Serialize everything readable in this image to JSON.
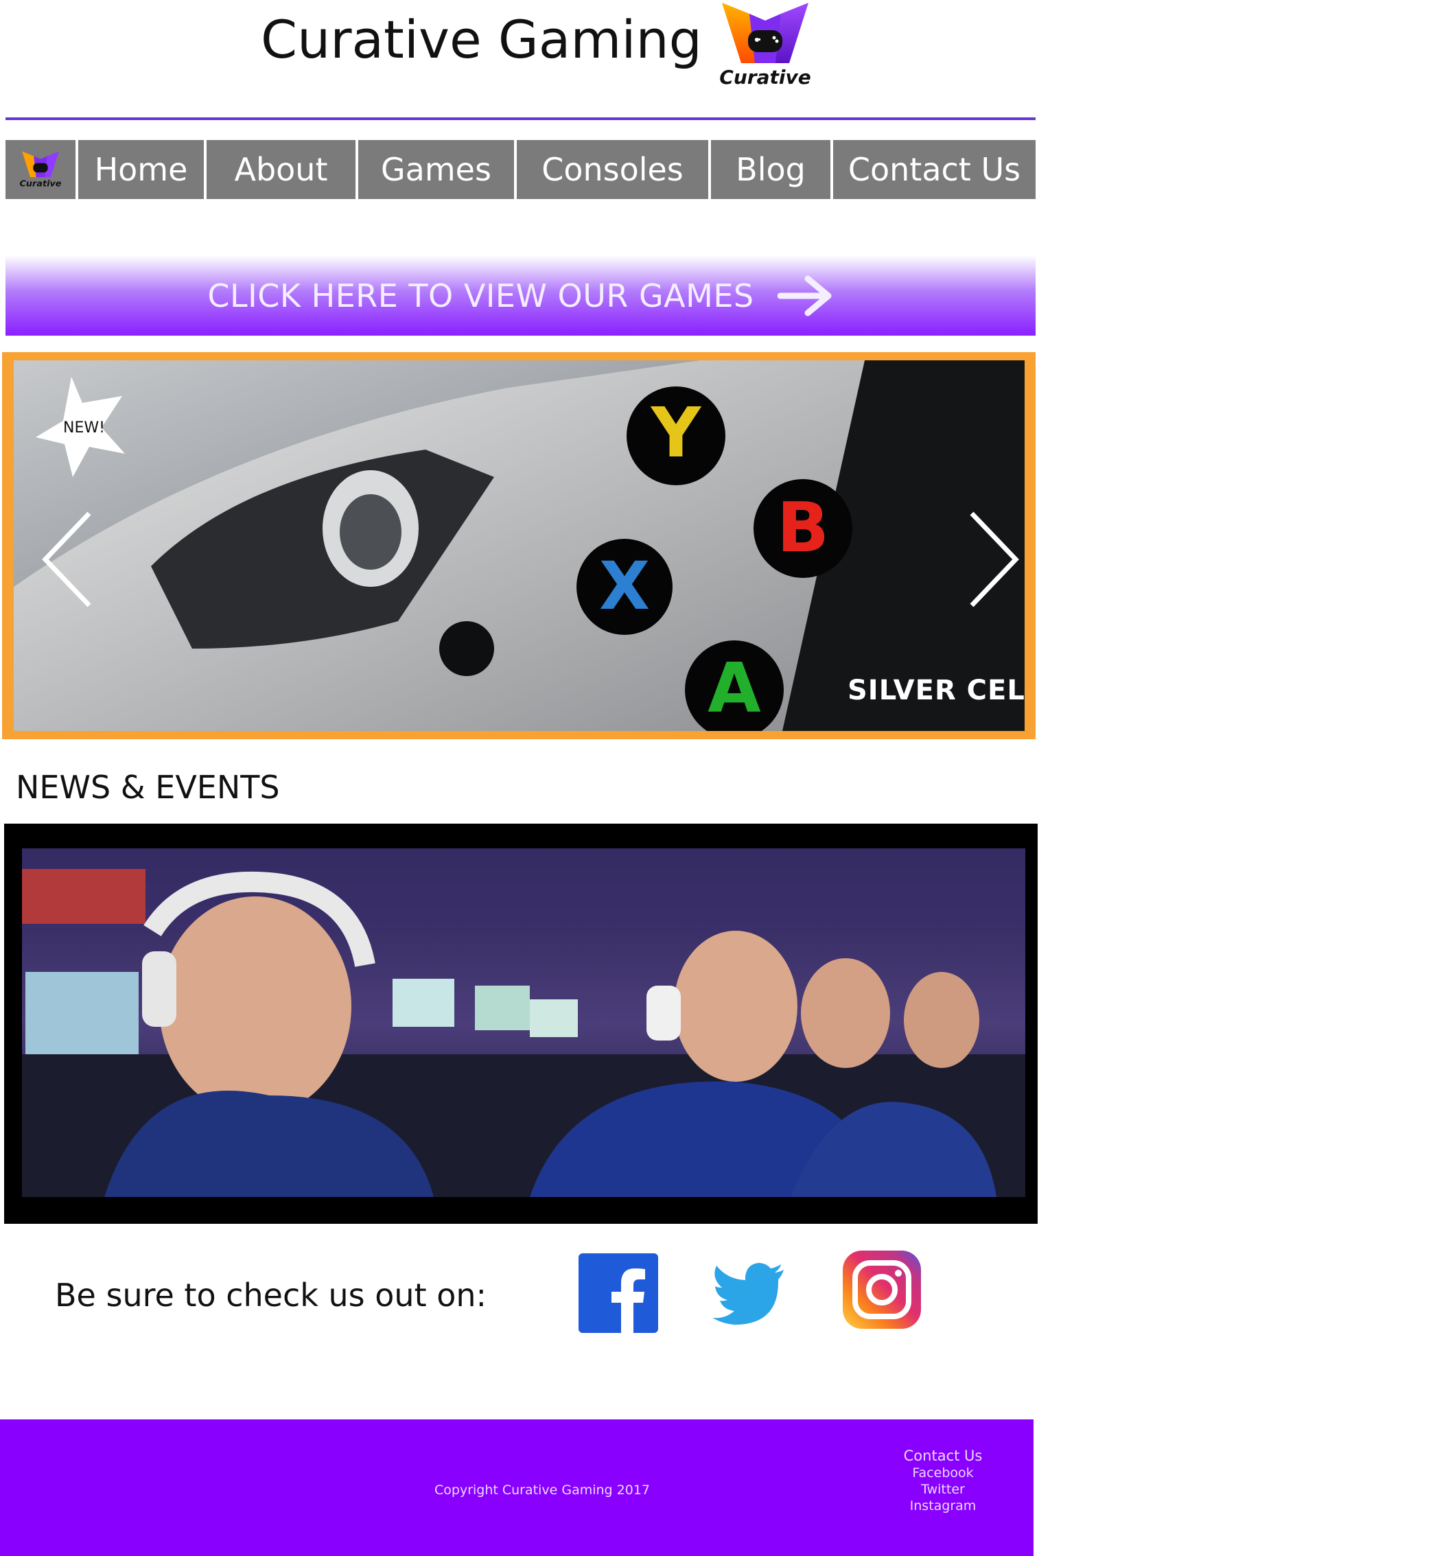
{
  "header": {
    "title": "Curative Gaming",
    "logo_text": "Curative"
  },
  "nav": {
    "logo_text": "Curative",
    "items": [
      {
        "label": "Home"
      },
      {
        "label": "About"
      },
      {
        "label": "Games"
      },
      {
        "label": "Consoles"
      },
      {
        "label": "Blog"
      },
      {
        "label": "Contact Us"
      }
    ]
  },
  "banner": {
    "label": "CLICK HERE TO VIEW OUR GAMES",
    "icon": "arrow-right-icon"
  },
  "slideshow": {
    "badge": "NEW!",
    "caption": "SILVER CELL",
    "prev_icon": "chevron-left-icon",
    "next_icon": "chevron-right-icon"
  },
  "news": {
    "heading": "NEWS & EVENTS"
  },
  "social": {
    "text": "Be sure to check us out on:",
    "icons": [
      "facebook-icon",
      "twitter-icon",
      "instagram-icon"
    ]
  },
  "footer": {
    "copyright": "Copyright Curative Gaming 2017",
    "links": [
      "Contact Us",
      "Facebook",
      "Twitter",
      "Instagram"
    ]
  },
  "colors": {
    "accent_purple": "#8a00ff",
    "nav_gray": "#7b7b7b",
    "slideshow_border": "#f8a233",
    "rule": "#6a35d6"
  }
}
